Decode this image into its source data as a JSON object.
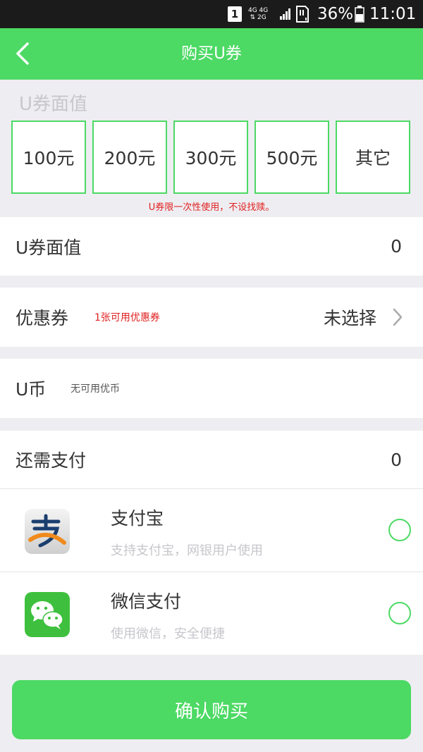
{
  "status_bar": {
    "sim_slot": "1",
    "network_top": "4G 4G",
    "network_bottom": "⇅ 2G",
    "battery_percent": "36%",
    "time": "11:01"
  },
  "header": {
    "title": "购买U券"
  },
  "denomination": {
    "heading": "U券面值",
    "options": [
      "100元",
      "200元",
      "300元",
      "500元",
      "其它"
    ],
    "note": "U券限一次性使用，不设找赎。"
  },
  "summary": {
    "face_value_label": "U券面值",
    "face_value": "0",
    "coupon_label": "优惠券",
    "coupon_hint": "1张可用优惠券",
    "coupon_value": "未选择",
    "ucoin_label": "U币",
    "ucoin_hint": "无可用优币",
    "remaining_label": "还需支付",
    "remaining_value": "0"
  },
  "payment_methods": [
    {
      "title": "支付宝",
      "subtitle": "支持支付宝，网银用户使用",
      "icon": "alipay-icon"
    },
    {
      "title": "微信支付",
      "subtitle": "使用微信，安全便捷",
      "icon": "wechat-icon"
    }
  ],
  "confirm_label": "确认购买",
  "colors": {
    "accent": "#4cd964",
    "warning_text": "#e02020",
    "background": "#eeeef2"
  }
}
